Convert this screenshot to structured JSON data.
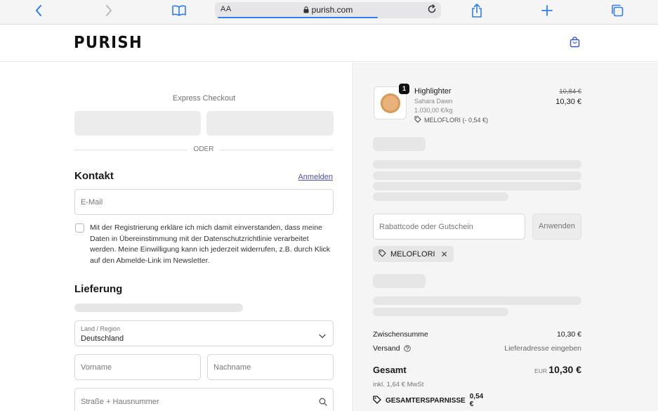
{
  "browser": {
    "aa_label": "AA",
    "url": "purish.com",
    "accent": "#2f7cf6"
  },
  "site": {
    "logo": "PURISH"
  },
  "express": {
    "title": "Express Checkout",
    "divider": "ODER"
  },
  "contact": {
    "title": "Kontakt",
    "login_link": "Anmelden",
    "email_placeholder": "E-Mail",
    "consent_text": "Mit der Registrierung erkläre ich mich damit einverstanden, dass meine Daten in Übereinstimmung mit der Datenschutzrichtlinie verarbeitet werden. Meine Einwilligung kann ich jederzeit widerrufen, z.B. durch Klick auf den Abmelde-Link im Newsletter."
  },
  "delivery": {
    "title": "Lieferung",
    "country_label": "Land / Region",
    "country_value": "Deutschland",
    "first_name_placeholder": "Vorname",
    "last_name_placeholder": "Nachname",
    "street_placeholder": "Straße + Hausnummer"
  },
  "cart": {
    "item": {
      "quantity": "1",
      "name": "Highlighter",
      "variant": "Sahara Dawn",
      "unit_price": "1.030,00 €/kg",
      "discount_tag": "MELOFLORI (- 0,54 €)",
      "old_price": "10,84 €",
      "price": "10,30 €"
    },
    "discount_placeholder": "Rabattcode oder Gutschein",
    "apply_label": "Anwenden",
    "applied_code": "MELOFLORI"
  },
  "summary": {
    "subtotal_label": "Zwischensumme",
    "subtotal_value": "10,30 €",
    "shipping_label": "Versand",
    "shipping_value": "Lieferadresse eingeben",
    "total_label": "Gesamt",
    "total_currency": "EUR",
    "total_value": "10,30 €",
    "tax_note": "inkl. 1,64 € MwSt",
    "savings_label": "GESAMTERSPARNISSE",
    "savings_value": "0,54 €"
  }
}
